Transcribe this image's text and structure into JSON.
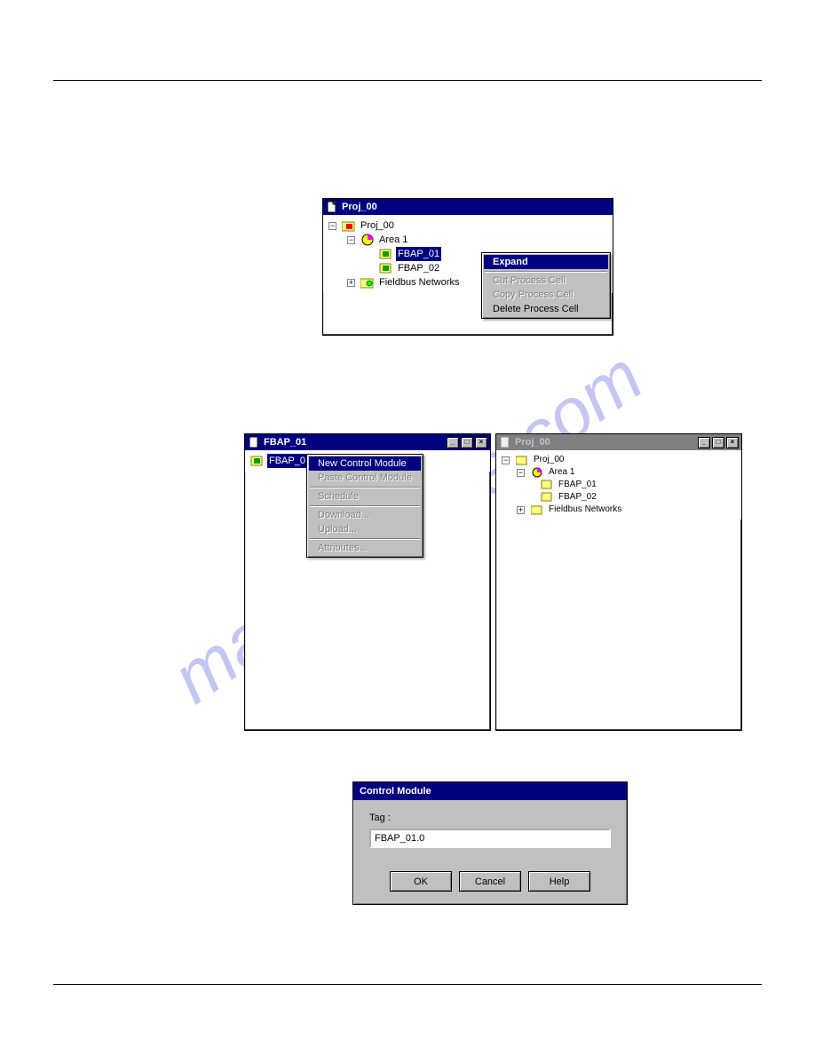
{
  "watermark": "manualshive.com",
  "win1": {
    "title": "Proj_00",
    "tree": {
      "root": "Proj_00",
      "area": "Area 1",
      "items": [
        "FBAP_01",
        "FBAP_02"
      ],
      "networks": "Fieldbus Networks",
      "selected": "FBAP_01"
    },
    "menu": {
      "expand": "Expand",
      "cut": "Cut Process Cell",
      "copy": "Copy Process Cell",
      "del": "Delete Process Cell"
    }
  },
  "win2": {
    "title": "FBAP_01",
    "root": "FBAP_01",
    "menu": {
      "newcm": "New Control Module",
      "pastecm": "Paste Control Module",
      "schedule": "Schedule",
      "download": "Download...",
      "upload": "Upload...",
      "attributes": "Attributes..."
    }
  },
  "win3": {
    "title": "Proj_00",
    "tree": {
      "root": "Proj_00",
      "area": "Area 1",
      "items": [
        "FBAP_01",
        "FBAP_02"
      ],
      "networks": "Fieldbus Networks"
    }
  },
  "dialog": {
    "title": "Control Module",
    "label": "Tag :",
    "value": "FBAP_01.0",
    "ok": "OK",
    "cancel": "Cancel",
    "help": "Help"
  }
}
